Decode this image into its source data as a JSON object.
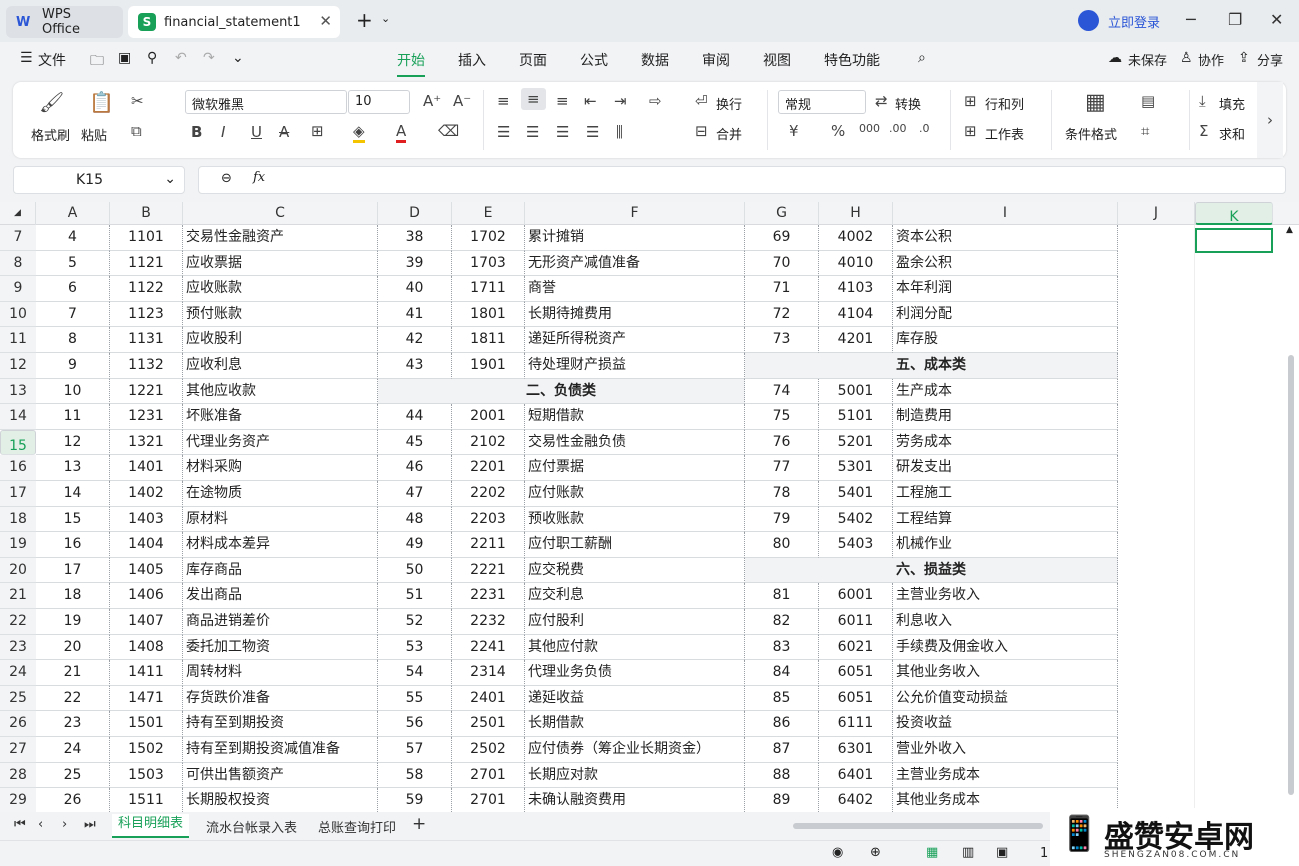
{
  "titlebar": {
    "app_tab": "WPS Office",
    "file_tab": "financial_statement1",
    "login": "立即登录"
  },
  "menu": {
    "file": "文件",
    "items": [
      "开始",
      "插入",
      "页面",
      "公式",
      "数据",
      "审阅",
      "视图",
      "特色功能"
    ],
    "unsaved": "未保存",
    "collab": "协作",
    "share": "分享"
  },
  "ribbon": {
    "format_painter": "格式刷",
    "paste": "粘贴",
    "font": "微软雅黑",
    "size": "10",
    "wrap": "换行",
    "merge": "合并",
    "number_format": "常规",
    "convert": "转换",
    "rowcol": "行和列",
    "worksheet": "工作表",
    "cond_format": "条件格式",
    "fill": "填充",
    "sum": "求和"
  },
  "namebox": "K15",
  "columns": [
    "A",
    "B",
    "C",
    "D",
    "E",
    "F",
    "G",
    "H",
    "I",
    "J",
    "K"
  ],
  "rows": [
    {
      "n": "7",
      "a": "4",
      "b": "1101",
      "c": "交易性金融资产",
      "d": "38",
      "e": "1702",
      "f": "累计摊销",
      "g": "69",
      "h": "4002",
      "i": "资本公积"
    },
    {
      "n": "8",
      "a": "5",
      "b": "1121",
      "c": "应收票据",
      "d": "39",
      "e": "1703",
      "f": "无形资产减值准备",
      "g": "70",
      "h": "4010",
      "i": "盈余公积"
    },
    {
      "n": "9",
      "a": "6",
      "b": "1122",
      "c": "应收账款",
      "d": "40",
      "e": "1711",
      "f": "商誉",
      "g": "71",
      "h": "4103",
      "i": "本年利润"
    },
    {
      "n": "10",
      "a": "7",
      "b": "1123",
      "c": "预付账款",
      "d": "41",
      "e": "1801",
      "f": "长期待摊费用",
      "g": "72",
      "h": "4104",
      "i": "利润分配"
    },
    {
      "n": "11",
      "a": "8",
      "b": "1131",
      "c": "应收股利",
      "d": "42",
      "e": "1811",
      "f": "递延所得税资产",
      "g": "73",
      "h": "4201",
      "i": "库存股"
    },
    {
      "n": "12",
      "a": "9",
      "b": "1132",
      "c": "应收利息",
      "d": "43",
      "e": "1901",
      "f": "待处理财产损益",
      "gsect": "五、成本类"
    },
    {
      "n": "13",
      "a": "10",
      "b": "1221",
      "c": "其他应收款",
      "dsect": "二、负债类",
      "g": "74",
      "h": "5001",
      "i": "生产成本"
    },
    {
      "n": "14",
      "a": "11",
      "b": "1231",
      "c": "坏账准备",
      "d": "44",
      "e": "2001",
      "f": "短期借款",
      "g": "75",
      "h": "5101",
      "i": "制造费用"
    },
    {
      "n": "15",
      "a": "12",
      "b": "1321",
      "c": "代理业务资产",
      "d": "45",
      "e": "2102",
      "f": "交易性金融负债",
      "g": "76",
      "h": "5201",
      "i": "劳务成本"
    },
    {
      "n": "16",
      "a": "13",
      "b": "1401",
      "c": "材料采购",
      "d": "46",
      "e": "2201",
      "f": "应付票据",
      "g": "77",
      "h": "5301",
      "i": "研发支出"
    },
    {
      "n": "17",
      "a": "14",
      "b": "1402",
      "c": "在途物质",
      "d": "47",
      "e": "2202",
      "f": "应付账款",
      "g": "78",
      "h": "5401",
      "i": "工程施工"
    },
    {
      "n": "18",
      "a": "15",
      "b": "1403",
      "c": "原材料",
      "d": "48",
      "e": "2203",
      "f": "预收账款",
      "g": "79",
      "h": "5402",
      "i": "工程结算"
    },
    {
      "n": "19",
      "a": "16",
      "b": "1404",
      "c": "材料成本差异",
      "d": "49",
      "e": "2211",
      "f": "应付职工薪酬",
      "g": "80",
      "h": "5403",
      "i": "机械作业"
    },
    {
      "n": "20",
      "a": "17",
      "b": "1405",
      "c": "库存商品",
      "d": "50",
      "e": "2221",
      "f": "应交税费",
      "gsect": "六、损益类"
    },
    {
      "n": "21",
      "a": "18",
      "b": "1406",
      "c": "发出商品",
      "d": "51",
      "e": "2231",
      "f": "应交利息",
      "g": "81",
      "h": "6001",
      "i": "主营业务收入"
    },
    {
      "n": "22",
      "a": "19",
      "b": "1407",
      "c": "商品进销差价",
      "d": "52",
      "e": "2232",
      "f": "应付股利",
      "g": "82",
      "h": "6011",
      "i": "利息收入"
    },
    {
      "n": "23",
      "a": "20",
      "b": "1408",
      "c": "委托加工物资",
      "d": "53",
      "e": "2241",
      "f": "其他应付款",
      "g": "83",
      "h": "6021",
      "i": "手续费及佣金收入"
    },
    {
      "n": "24",
      "a": "21",
      "b": "1411",
      "c": "周转材料",
      "d": "54",
      "e": "2314",
      "f": "代理业务负债",
      "g": "84",
      "h": "6051",
      "i": "其他业务收入"
    },
    {
      "n": "25",
      "a": "22",
      "b": "1471",
      "c": "存货跌价准备",
      "d": "55",
      "e": "2401",
      "f": "递延收益",
      "g": "85",
      "h": "6051",
      "i": "公允价值变动损益"
    },
    {
      "n": "26",
      "a": "23",
      "b": "1501",
      "c": "持有至到期投资",
      "d": "56",
      "e": "2501",
      "f": "长期借款",
      "g": "86",
      "h": "6111",
      "i": "投资收益"
    },
    {
      "n": "27",
      "a": "24",
      "b": "1502",
      "c": "持有至到期投资减值准备",
      "d": "57",
      "e": "2502",
      "f": "应付债券（筹企业长期资金）",
      "g": "87",
      "h": "6301",
      "i": "营业外收入"
    },
    {
      "n": "28",
      "a": "25",
      "b": "1503",
      "c": "可供出售额资产",
      "d": "58",
      "e": "2701",
      "f": "长期应对款",
      "g": "88",
      "h": "6401",
      "i": "主营业务成本"
    },
    {
      "n": "29",
      "a": "26",
      "b": "1511",
      "c": "长期股权投资",
      "d": "59",
      "e": "2701",
      "f": "未确认融资费用",
      "g": "89",
      "h": "6402",
      "i": "其他业务成本"
    }
  ],
  "sheets": [
    "科目明细表",
    "流水台帐录入表",
    "总账查询打印"
  ],
  "watermark": {
    "name": "盛赞安卓网",
    "url": "SHENGZAN08.COM.CN"
  },
  "status": {
    "zoom": "1"
  }
}
